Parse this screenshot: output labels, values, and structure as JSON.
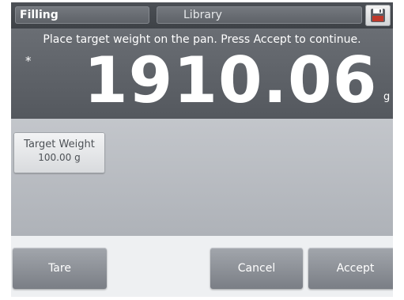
{
  "topbar": {
    "app_name": "Filling",
    "library_label": "Library",
    "save_icon": "floppy-disk-icon"
  },
  "display": {
    "instruction": "Place target weight on the pan.  Press Accept to continue.",
    "stable_mark": "*",
    "weight": "1910.06",
    "unit": "g"
  },
  "content": {
    "target_weight_label": "Target Weight",
    "target_weight_value": "100.00 g"
  },
  "buttons": {
    "tare": "Tare",
    "cancel": "Cancel",
    "accept": "Accept"
  },
  "colors": {
    "save_icon_accent": "#c0392b"
  }
}
